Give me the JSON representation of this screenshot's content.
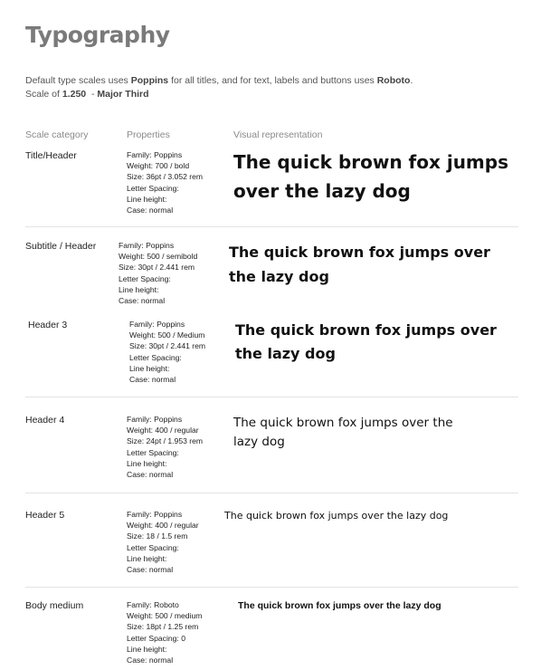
{
  "title": "Typography",
  "intro": {
    "line1_pre": "Default type scales uses ",
    "font_titles": "Poppins",
    "line1_mid": " for all titles, and for text, labels and buttons uses ",
    "font_text": "Roboto",
    "line1_end": ".",
    "line2_pre": "Scale of ",
    "scale_value": "1.250",
    "line2_sep": "  - ",
    "scale_name": "Major Third"
  },
  "columns": {
    "category": "Scale category",
    "properties": "Properties",
    "visual": "Visual representation"
  },
  "rows": [
    {
      "category": "Title/Header",
      "family": "Family: Poppins",
      "weight": "Weight: 700 / bold",
      "size": "Size: 36pt / 3.052 rem",
      "spacing": "Letter Spacing:",
      "line_height": "Line height:",
      "case": "Case: normal",
      "sample_line1": "The quick brown fox jumps",
      "sample_line2": "over the lazy dog"
    },
    {
      "category": "Subtitle / Header",
      "family": "Family: Poppins",
      "weight": "Weight: 500 / semibold",
      "size": "Size: 30pt / 2.441 rem",
      "spacing": "Letter Spacing:",
      "line_height": "Line height:",
      "case": "Case: normal",
      "sample_line1": "The quick brown fox jumps over",
      "sample_line2": "the lazy dog"
    },
    {
      "category": "Header 3",
      "family": "Family: Poppins",
      "weight": "Weight: 500 / Medium",
      "size": "Size: 30pt / 2.441 rem",
      "spacing": "Letter Spacing:",
      "line_height": "Line height:",
      "case": "Case: normal",
      "sample_line1": "The quick brown fox jumps over",
      "sample_line2": "the lazy dog"
    },
    {
      "category": "Header 4",
      "family": "Family: Poppins",
      "weight": "Weight: 400 / regular",
      "size": "Size: 24pt / 1.953 rem",
      "spacing": "Letter Spacing:",
      "line_height": "Line height:",
      "case": "Case: normal",
      "sample_line1": "The quick brown fox jumps over the",
      "sample_line2": "lazy dog"
    },
    {
      "category": "Header 5",
      "family": "Family: Poppins",
      "weight": "Weight: 400 / regular",
      "size": "Size: 18 / 1.5 rem",
      "spacing": "Letter Spacing:",
      "line_height": "Line height:",
      "case": "Case: normal",
      "sample_line1": "The quick brown fox jumps over the lazy dog",
      "sample_line2": ""
    },
    {
      "category": "Body medium",
      "family": "Family: Roboto",
      "weight": "Weight: 500 / medium",
      "size": "Size: 18pt / 1.25 rem",
      "spacing": "Letter Spacing: 0",
      "line_height": "Line height:",
      "case": "Case: normal",
      "sample_line1": "The quick brown fox jumps over the lazy dog",
      "sample_line2": ""
    }
  ]
}
